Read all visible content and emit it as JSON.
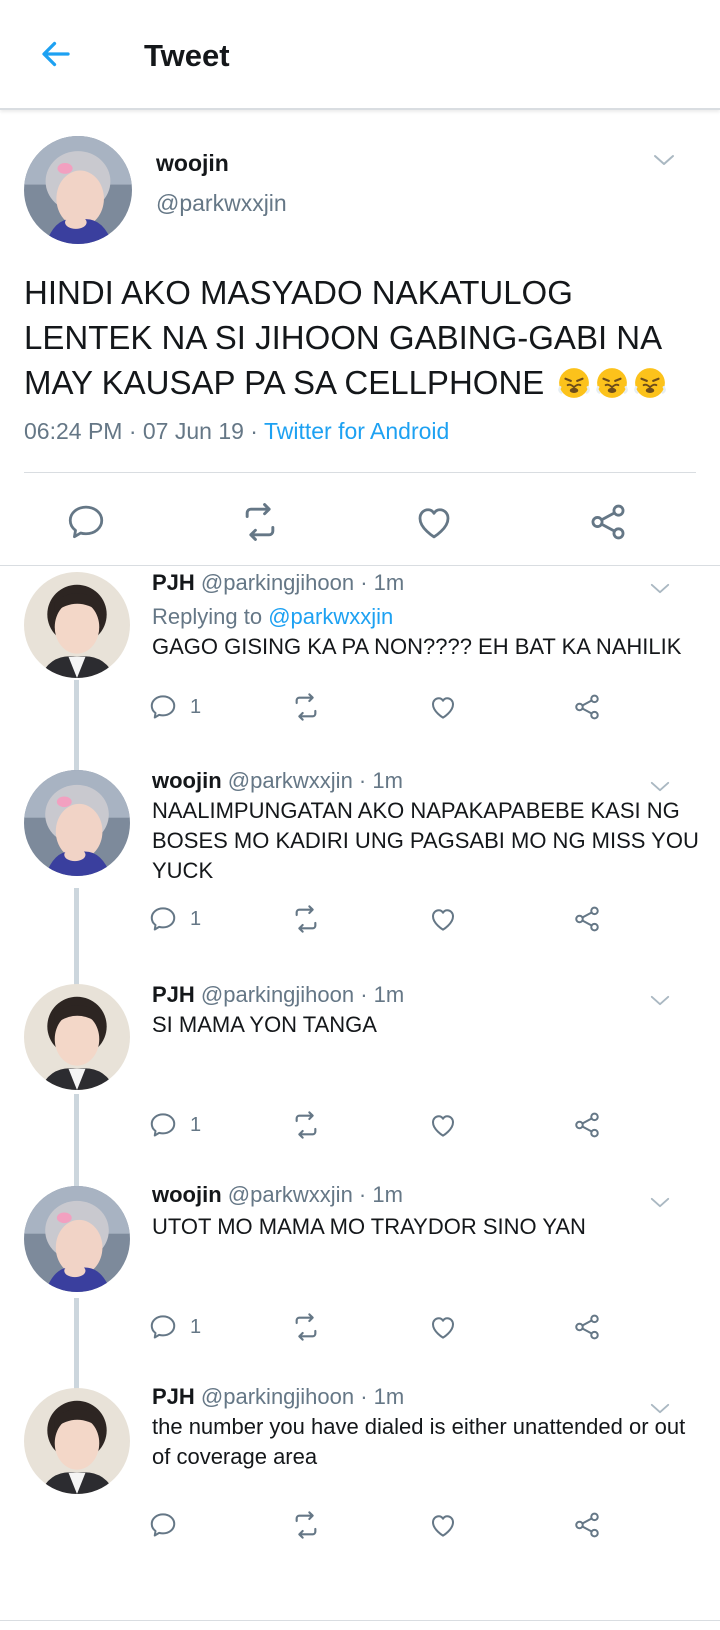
{
  "header": {
    "title": "Tweet"
  },
  "main_tweet": {
    "author_name": "woojin",
    "author_handle": "@parkwxxjin",
    "text": "HINDI AKO MASYADO NAKATULOG LENTEK NA SI JIHOON GABING-GABI NA MAY KAUSAP PA SA CELLPHONE",
    "emoji": "😤😤😤",
    "time": "06:24 PM · 07 Jun 19 ·",
    "source": "Twitter for Android"
  },
  "replies": [
    {
      "name": "PJH",
      "handle": "@parkingjihoon · 1m",
      "replying_label": "Replying to",
      "replying_to": "@parkwxxjin",
      "text": "GAGO GISING KA PA NON???? EH BAT KA NAHILIK",
      "reply_count": "1"
    },
    {
      "name": "woojin",
      "handle": "@parkwxxjin · 1m",
      "text": "NAALIMPUNGATAN AKO NAPAKAPABEBE KASI NG BOSES MO KADIRI UNG PAGSABI MO NG MISS YOU YUCK",
      "reply_count": "1"
    },
    {
      "name": "PJH",
      "handle": "@parkingjihoon · 1m",
      "text": "SI MAMA YON TANGA",
      "reply_count": "1"
    },
    {
      "name": "woojin",
      "handle": "@parkwxxjin · 1m",
      "text": "UTOT MO MAMA MO TRAYDOR SINO YAN",
      "reply_count": "1"
    },
    {
      "name": "PJH",
      "handle": "@parkingjihoon · 1m",
      "text": "the number you have dialed is either unattended or out of coverage area",
      "reply_count": ""
    }
  ],
  "icons": {
    "back": "arrow-left-icon",
    "chevron": "chevron-down-icon",
    "reply": "speech-bubble-icon",
    "retweet": "retweet-icon",
    "like": "heart-icon",
    "share": "share-icon"
  },
  "colors": {
    "accent": "#1da1f2",
    "text": "#14171a",
    "secondary": "#657786",
    "divider": "#d9dde1",
    "thread_line": "#ccd6dd"
  }
}
